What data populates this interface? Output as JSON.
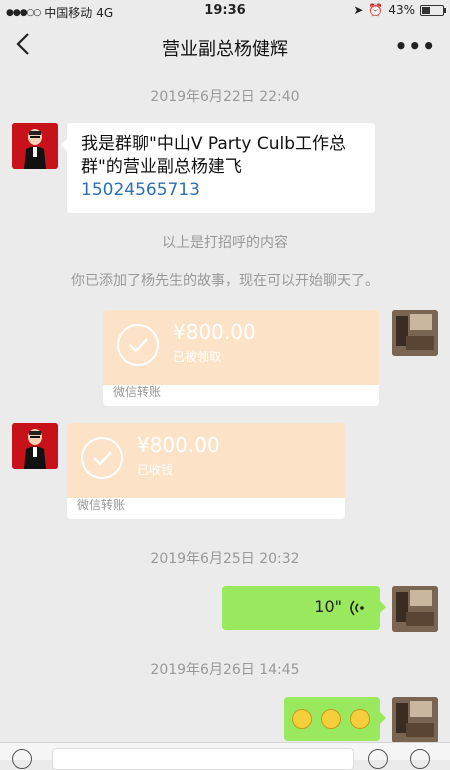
{
  "status_bar": {
    "carrier": "中国移动",
    "network": "4G",
    "time": "19:36",
    "battery": "43%"
  },
  "nav": {
    "title": "营业副总杨健辉",
    "more": "•••"
  },
  "messages": {
    "ts1": "2019年6月22日 22:40",
    "greeting_text": "我是群聊\"中山V Party Culb工作总群\"的营业副总杨建飞",
    "greeting_phone": "15024565713",
    "sys1": "以上是打招呼的内容",
    "sys2": "你已添加了杨先生的故事，现在可以开始聊天了。",
    "transfer1": {
      "amount": "¥800.00",
      "status": "已被领取",
      "label": "微信转账"
    },
    "transfer2": {
      "amount": "¥800.00",
      "status": "已收钱",
      "label": "微信转账"
    },
    "ts2": "2019年6月25日 20:32",
    "voice_duration": "10\"",
    "ts3": "2019年6月26日 14:45"
  },
  "colors": {
    "accent_green": "#9ae85d",
    "transfer_orange": "#fce3c7",
    "background": "#ebebeb"
  }
}
